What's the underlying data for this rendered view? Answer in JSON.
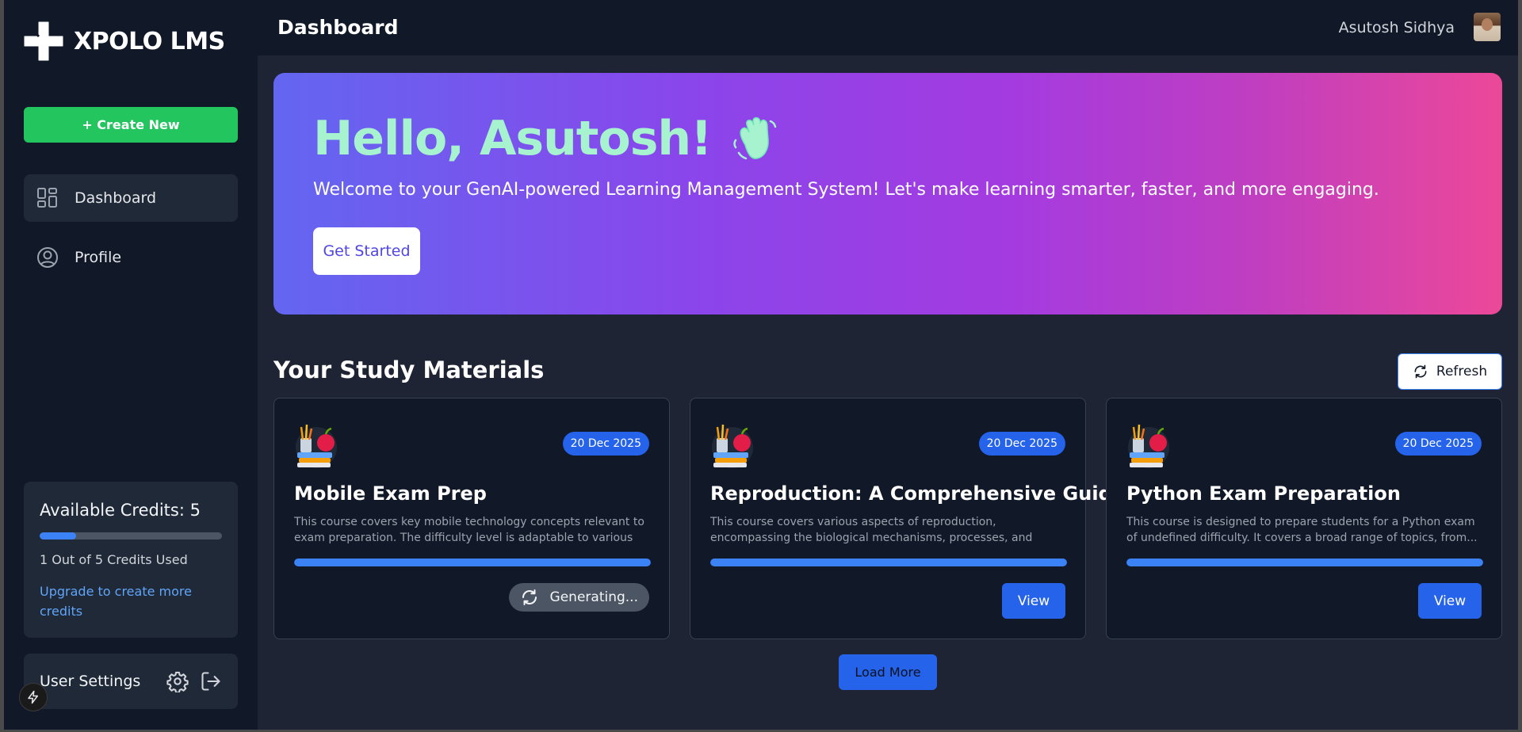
{
  "app": {
    "name": "XPOLO LMS"
  },
  "sidebar": {
    "create_label": "+ Create New",
    "items": [
      {
        "label": "Dashboard",
        "icon": "dashboard-grid-icon",
        "active": true
      },
      {
        "label": "Profile",
        "icon": "user-circle-icon",
        "active": false
      }
    ],
    "credits": {
      "title": "Available Credits: 5",
      "used_text": "1 Out of 5 Credits Used",
      "used_fraction": 0.2,
      "upgrade_text": "Upgrade to create more credits"
    },
    "settings_label": "User Settings"
  },
  "header": {
    "title": "Dashboard",
    "user_name": "Asutosh Sidhya"
  },
  "hero": {
    "greeting": "Hello, Asutosh!",
    "subtitle": "Welcome to your GenAI-powered Learning Management System! Let's make learning smarter, faster, and more engaging.",
    "button_label": "Get Started"
  },
  "materials": {
    "title": "Your Study Materials",
    "refresh_label": "Refresh",
    "load_more_label": "Load More",
    "courses": [
      {
        "title": "Mobile Exam Prep",
        "date": "20 Dec 2025",
        "description": "This course covers key mobile technology concepts relevant to exam preparation. The difficulty level is adaptable to various exa...",
        "status": "Generating...",
        "progress": 1.0
      },
      {
        "title": "Reproduction: A Comprehensive Guide",
        "date": "20 Dec 2025",
        "description": "This course covers various aspects of reproduction, encompassing the biological mechanisms, processes, and diverse reproductive...",
        "action": "View",
        "progress": 1.0
      },
      {
        "title": "Python Exam Preparation",
        "date": "20 Dec 2025",
        "description": "This course is designed to prepare students for a Python exam of undefined difficulty. It covers a broad range of topics, from...",
        "action": "View",
        "progress": 1.0
      }
    ]
  },
  "colors": {
    "sidebar_bg": "#111827",
    "accent_green": "#22c55e",
    "accent_blue": "#2563eb",
    "hero_gradient_start": "#6366f1",
    "hero_gradient_end": "#ec4899",
    "greeting_color": "#a7f3d0"
  }
}
